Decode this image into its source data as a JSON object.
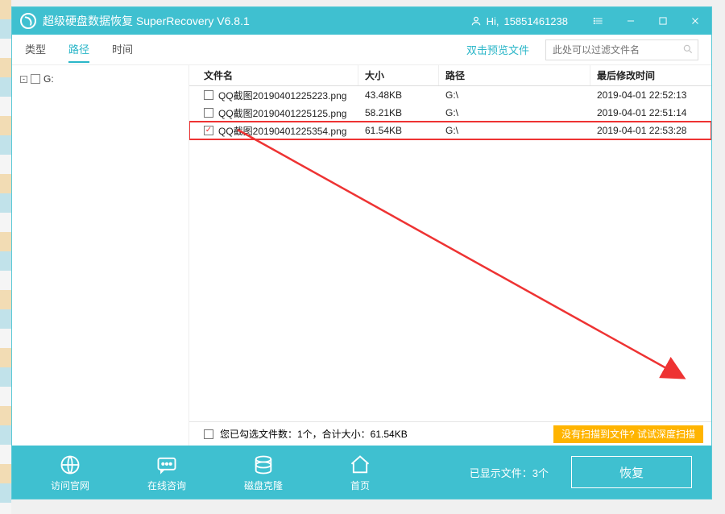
{
  "titlebar": {
    "title": "超级硬盘数据恢复 SuperRecovery V6.8.1",
    "user_prefix": "Hi,",
    "user_id": "15851461238"
  },
  "toolbar": {
    "tabs": {
      "type": "类型",
      "path": "路径",
      "time": "时间"
    },
    "active_tab": "path",
    "preview_label": "双击预览文件",
    "search_placeholder": "此处可以过滤文件名"
  },
  "sidebar": {
    "root_label": "G:"
  },
  "columns": {
    "name": "文件名",
    "size": "大小",
    "path": "路径",
    "time": "最后修改时间"
  },
  "rows": [
    {
      "checked": false,
      "name": "QQ截图20190401225223.png",
      "size": "43.48KB",
      "path": "G:\\",
      "time": "2019-04-01 22:52:13",
      "highlight": false
    },
    {
      "checked": false,
      "name": "QQ截图20190401225125.png",
      "size": "58.21KB",
      "path": "G:\\",
      "time": "2019-04-01 22:51:14",
      "highlight": false
    },
    {
      "checked": true,
      "name": "QQ截图20190401225354.png",
      "size": "61.54KB",
      "path": "G:\\",
      "time": "2019-04-01 22:53:28",
      "highlight": true
    }
  ],
  "statusbar": {
    "summary": "您已勾选文件数：1个，合计大小：61.54KB",
    "deep_scan": "没有扫描到文件? 试试深度扫描"
  },
  "footer": {
    "btn_site": "访问官网",
    "btn_chat": "在线咨询",
    "btn_clone": "磁盘克隆",
    "btn_home": "首页",
    "shown": "已显示文件：3个",
    "recover": "恢复"
  },
  "colors": {
    "accent": "#3fc0d0",
    "highlight": "#e33",
    "warn": "#ffb400"
  }
}
